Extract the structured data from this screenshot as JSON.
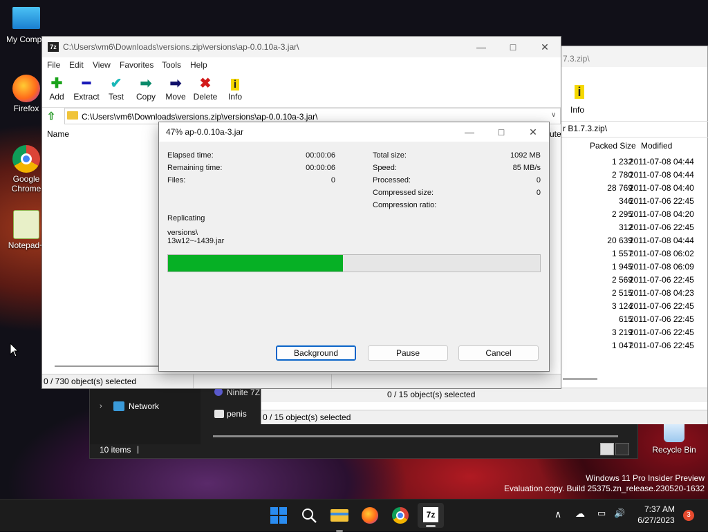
{
  "desktop": {
    "icons": [
      {
        "label": "My Compu"
      },
      {
        "label": "Firefox"
      },
      {
        "label": "Google Chrome"
      },
      {
        "label": "Notepad+"
      },
      {
        "label": "Recycle Bin"
      }
    ],
    "watermark_line1": "Windows 11 Pro Insider Preview",
    "watermark_line2": "Evaluation copy. Build 25375.zn_release.230520-1632"
  },
  "explorer": {
    "nav_network": "Network",
    "nav_ninite": "Ninite 7Z",
    "nav_penis": "penis",
    "items_count": "10 items"
  },
  "back_window": {
    "title_fragment": "7.3.zip\\",
    "toolbar_info": "Info",
    "address": "r B1.7.3.zip\\",
    "col_packed": "Packed Size",
    "col_modified": "Modified",
    "rows": [
      {
        "packed": "1 232",
        "modified": "2011-07-08 04:44"
      },
      {
        "packed": "2 780",
        "modified": "2011-07-08 04:44"
      },
      {
        "packed": "28 769",
        "modified": "2011-07-08 04:40"
      },
      {
        "packed": "346",
        "modified": "2011-07-06 22:45"
      },
      {
        "packed": "2 295",
        "modified": "2011-07-08 04:20"
      },
      {
        "packed": "312",
        "modified": "2011-07-06 22:45"
      },
      {
        "packed": "20 639",
        "modified": "2011-07-08 04:44"
      },
      {
        "packed": "1 557",
        "modified": "2011-07-08 06:02"
      },
      {
        "packed": "1 945",
        "modified": "2011-07-08 06:09"
      },
      {
        "packed": "2 569",
        "modified": "2011-07-06 22:45"
      },
      {
        "packed": "2 515",
        "modified": "2011-07-08 04:23"
      },
      {
        "packed": "3 124",
        "modified": "2011-07-06 22:45"
      },
      {
        "packed": "615",
        "modified": "2011-07-06 22:45"
      },
      {
        "packed": "3 219",
        "modified": "2011-07-06 22:45"
      },
      {
        "packed": "1 047",
        "modified": "2011-07-06 22:45"
      }
    ],
    "status1": "0 / 15 object(s) selected",
    "status2": "0 / 15 object(s) selected"
  },
  "main_window": {
    "title": "C:\\Users\\vm6\\Downloads\\versions.zip\\versions\\ap-0.0.10a-3.jar\\",
    "menu": [
      "File",
      "Edit",
      "View",
      "Favorites",
      "Tools",
      "Help"
    ],
    "toolbar": {
      "add": "Add",
      "extract": "Extract",
      "test": "Test",
      "copy": "Copy",
      "move": "Move",
      "delete": "Delete",
      "info": "Info"
    },
    "address": "C:\\Users\\vm6\\Downloads\\versions.zip\\versions\\ap-0.0.10a-3.jar\\",
    "col_name": "Name",
    "col_cut": "ute",
    "status": "0 / 730 object(s) selected"
  },
  "dialog": {
    "title": "47% ap-0.0.10a-3.jar",
    "elapsed_label": "Elapsed time:",
    "elapsed_value": "00:00:06",
    "remaining_label": "Remaining time:",
    "remaining_value": "00:00:06",
    "files_label": "Files:",
    "files_value": "0",
    "total_label": "Total size:",
    "total_value": "1092 MB",
    "speed_label": "Speed:",
    "speed_value": "85 MB/s",
    "processed_label": "Processed:",
    "processed_value": "0",
    "compressed_label": "Compressed size:",
    "compressed_value": "0",
    "ratio_label": "Compression ratio:",
    "operation": "Replicating",
    "path1": "versions\\",
    "path2": "13w12~-1439.jar",
    "progress_percent": 47,
    "btn_background": "Background",
    "btn_pause": "Pause",
    "btn_cancel": "Cancel"
  },
  "taskbar": {
    "time": "7:37 AM",
    "date": "6/27/2023",
    "notification_count": "3"
  },
  "colors": {
    "progress": "#06b025",
    "accent": "#0a64c8"
  }
}
